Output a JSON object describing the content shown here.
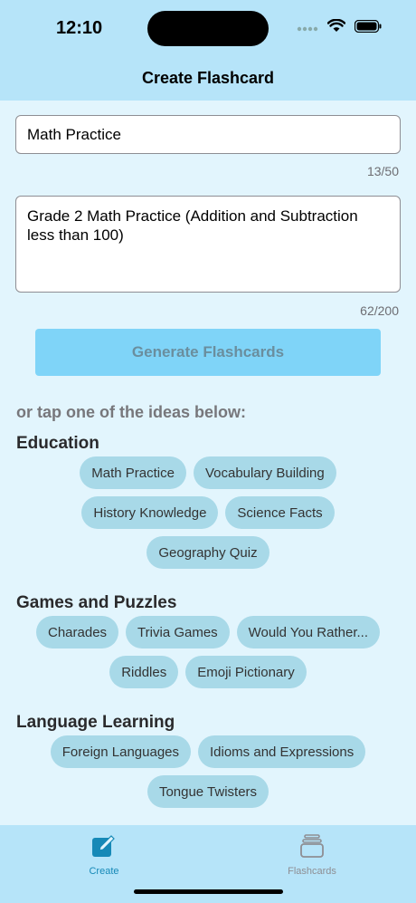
{
  "status_bar": {
    "time": "12:10"
  },
  "nav": {
    "title": "Create Flashcard"
  },
  "form": {
    "title_value": "Math Practice",
    "title_counter": "13/50",
    "description_value": "Grade 2 Math Practice (Addition and Subtraction less than 100)",
    "description_counter": "62/200",
    "generate_label": "Generate Flashcards"
  },
  "ideas": {
    "hint": "or tap one of the ideas below:",
    "sections": [
      {
        "title": "Education",
        "chips": [
          "Math Practice",
          "Vocabulary Building",
          "History Knowledge",
          "Science Facts",
          "Geography Quiz"
        ]
      },
      {
        "title": "Games and Puzzles",
        "chips": [
          "Charades",
          "Trivia Games",
          "Would You Rather...",
          "Riddles",
          "Emoji Pictionary"
        ]
      },
      {
        "title": "Language Learning",
        "chips": [
          "Foreign Languages",
          "Idioms and Expressions",
          "Tongue Twisters"
        ]
      }
    ]
  },
  "tabbar": {
    "tabs": [
      {
        "label": "Create",
        "icon": "pencil-square-icon",
        "active": true
      },
      {
        "label": "Flashcards",
        "icon": "card-stack-icon",
        "active": false
      }
    ]
  },
  "colors": {
    "header_bg": "#b6e4f9",
    "page_bg": "#e2f5fd",
    "button_bg": "#7fd4f8",
    "chip_bg": "#a8d9e8",
    "active_tab": "#1689b7"
  }
}
